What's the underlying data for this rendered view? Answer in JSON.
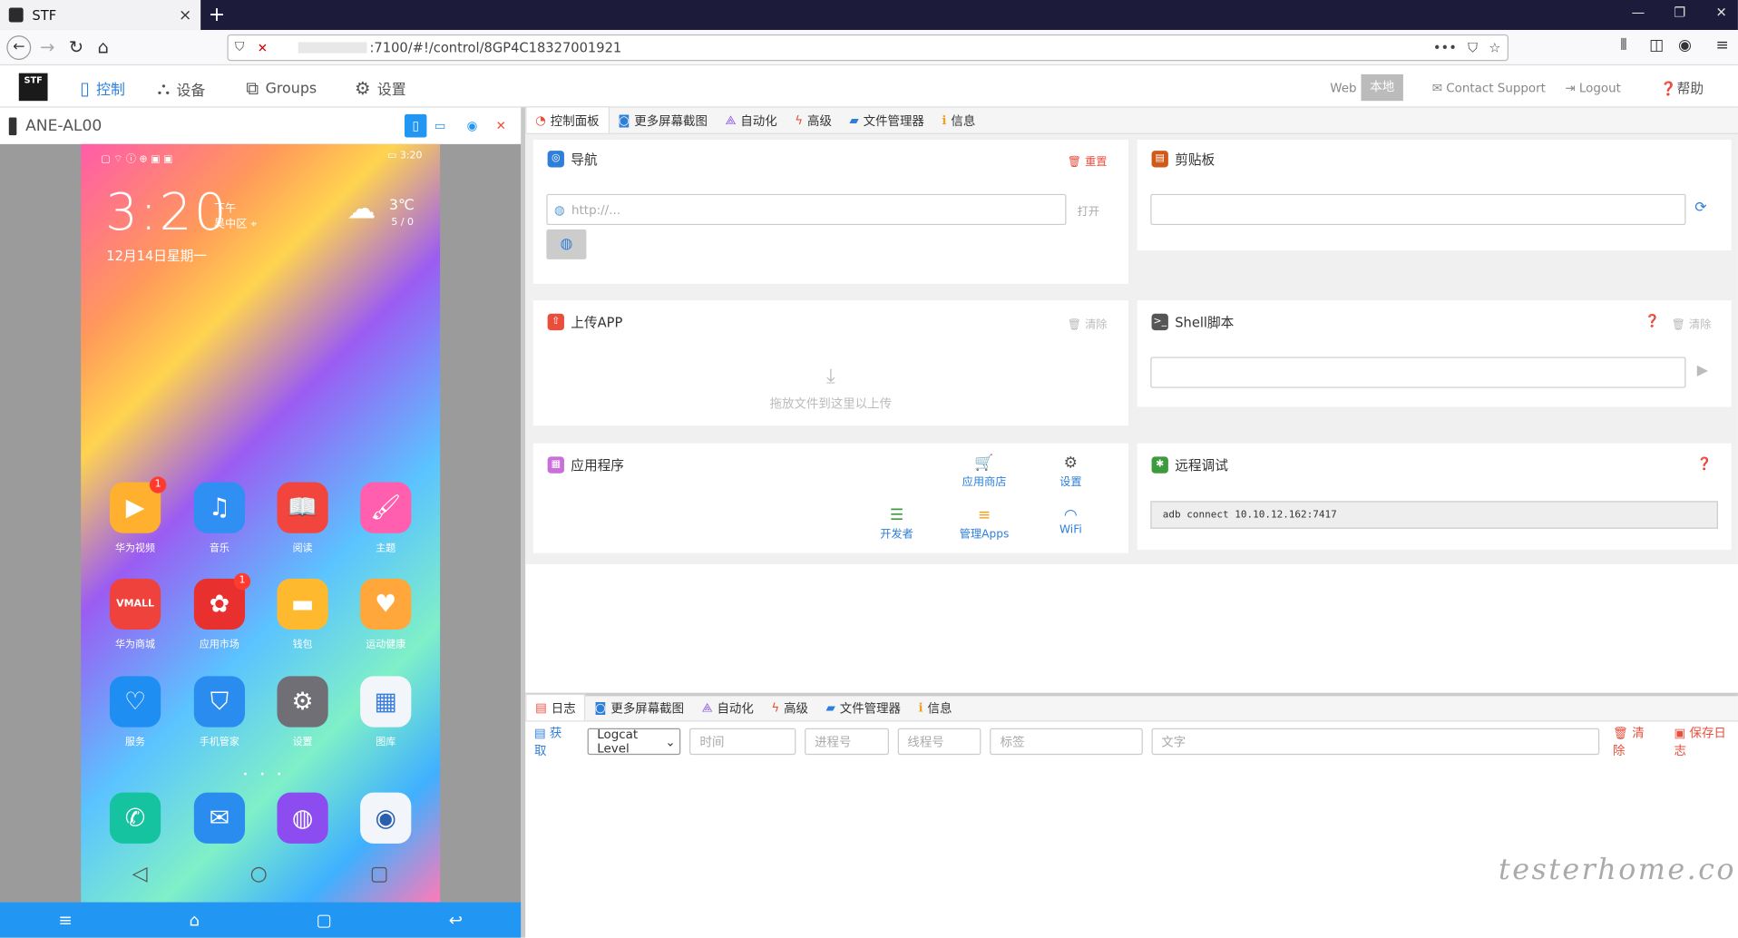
{
  "browser": {
    "tab_title": "STF",
    "tab_close": "×",
    "new_tab": "+",
    "url": ":7100/#!/control/8GP4C18327001921",
    "win_min": "—",
    "win_restore": "❐",
    "win_close": "✕"
  },
  "appbar": {
    "logo": "STF",
    "menu": [
      {
        "label": "控制",
        "icon": "▯",
        "active": true
      },
      {
        "label": "设备",
        "icon": "⛬"
      },
      {
        "label": "Groups",
        "icon": "⧉"
      },
      {
        "label": "设置",
        "icon": "⚙"
      }
    ],
    "web_label": "Web",
    "local_label": "本地",
    "contact": "Contact Support",
    "logout": "Logout",
    "help": "帮助"
  },
  "device": {
    "name": "ANE-AL00",
    "time": "3:20",
    "clock_main": "3:20",
    "clock_ampm": "下午",
    "clock_location": "吴中区",
    "date": "12月14日星期一",
    "temp": "3℃",
    "temp_range": "5 / 0",
    "apps": [
      {
        "label": "华为视频",
        "icon": "▶",
        "color": "#ffb02e",
        "badge": "1"
      },
      {
        "label": "音乐",
        "icon": "♫",
        "color": "#2f8ff2"
      },
      {
        "label": "阅读",
        "icon": "📖",
        "color": "#f2453d"
      },
      {
        "label": "主题",
        "icon": "🖌",
        "color": "#ff5fae"
      },
      {
        "label": "华为商城",
        "icon": "VMALL",
        "color": "#f0423c"
      },
      {
        "label": "应用市场",
        "icon": "✿",
        "color": "#e8302f",
        "badge": "1"
      },
      {
        "label": "钱包",
        "icon": "▬",
        "color": "#ffb92e"
      },
      {
        "label": "运动健康",
        "icon": "♥",
        "color": "#ffa73a"
      },
      {
        "label": "服务",
        "icon": "♡",
        "color": "#1e8ef2"
      },
      {
        "label": "手机管家",
        "icon": "⛉",
        "color": "#2b8cf0"
      },
      {
        "label": "设置",
        "icon": "⚙",
        "color": "#6f6f75"
      },
      {
        "label": "图库",
        "icon": "▦",
        "color": "#f2f6fa"
      }
    ],
    "dock": [
      {
        "icon": "✆",
        "color": "#16c3a0"
      },
      {
        "icon": "✉",
        "color": "#2b8cf0"
      },
      {
        "icon": "◍",
        "color": "#8c4cf0"
      },
      {
        "icon": "◉",
        "color": "#f2f6fa"
      }
    ]
  },
  "right_tabs": [
    {
      "label": "控制面板",
      "icon": "◔",
      "active": true
    },
    {
      "label": "更多屏幕截图",
      "icon": "◙"
    },
    {
      "label": "自动化",
      "icon": "⟁"
    },
    {
      "label": "高级",
      "icon": "ϟ"
    },
    {
      "label": "文件管理器",
      "icon": "▰"
    },
    {
      "label": "信息",
      "icon": "ℹ"
    }
  ],
  "nav_card": {
    "title": "导航",
    "reset": "重置",
    "placeholder": "http://...",
    "open": "打开"
  },
  "clip_card": {
    "title": "剪贴板"
  },
  "upload_card": {
    "title": "上传APP",
    "clear": "清除",
    "hint": "拖放文件到这里以上传"
  },
  "shell_card": {
    "title": "Shell脚本",
    "clear": "清除"
  },
  "apps_card": {
    "title": "应用程序",
    "store": "应用商店",
    "settings": "设置",
    "dev": "开发者",
    "manage": "管理Apps",
    "wifi": "WiFi"
  },
  "remote_card": {
    "title": "远程调试",
    "cmd": "adb connect 10.10.12.162:7417"
  },
  "bottom_tabs": [
    {
      "label": "日志",
      "icon": "▤",
      "active": true
    },
    {
      "label": "更多屏幕截图",
      "icon": "◙"
    },
    {
      "label": "自动化",
      "icon": "⟁"
    },
    {
      "label": "高级",
      "icon": "ϟ"
    },
    {
      "label": "文件管理器",
      "icon": "▰"
    },
    {
      "label": "信息",
      "icon": "ℹ"
    }
  ],
  "log": {
    "fetch": "获取",
    "level": "Logcat Level",
    "time": "时间",
    "pid": "进程号",
    "tid": "线程号",
    "tag": "标签",
    "text": "文字",
    "clear": "清除",
    "save": "保存日志"
  },
  "watermark": "testerhome.com",
  "colors": {
    "accent": "#2196f3",
    "danger": "#e94e3c",
    "link": "#2e7fd9"
  }
}
